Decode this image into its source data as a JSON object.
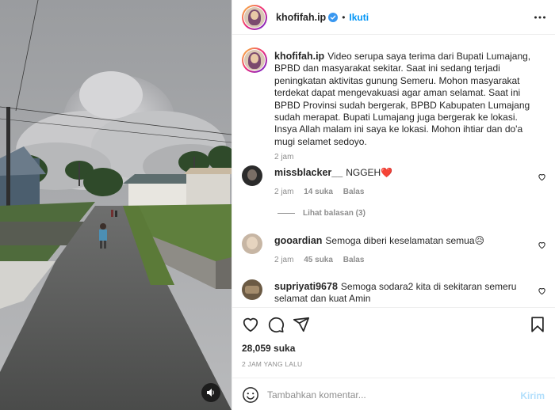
{
  "post": {
    "username": "khofifah.ip",
    "follow_label": "Ikuti",
    "caption": "Video serupa saya terima dari Bupati Lumajang, BPBD dan masyarakat sekitar. Saat ini sedang terjadi peningkatan aktivitas gunung Semeru. Mohon masyarakat terdekat dapat mengevakuasi agar aman selamat. Saat ini BPBD Provinsi sudah bergerak, BPBD Kabupaten Lumajang sudah merapat. Bupati Lumajang juga bergerak ke lokasi. Insya Allah malam ini saya ke lokasi. Mohon ihtiar dan do'a mugi selamet sedoyo.",
    "caption_age": "2 jam",
    "likes_text": "28,059 suka",
    "timestamp": "2 JAM YANG LALU"
  },
  "comments": [
    {
      "username": "missblacker__",
      "text": "NGGEH❤️",
      "age": "2 jam",
      "likes": "14 suka",
      "reply_label": "Balas",
      "view_replies": "Lihat balasan (3)"
    },
    {
      "username": "gooardian",
      "text": "Semoga diberi keselamatan semua😥",
      "age": "2 jam",
      "likes": "45 suka",
      "reply_label": "Balas"
    },
    {
      "username": "supriyati9678",
      "text": "Semoga sodara2 kita di sekitaran semeru selamat dan kuat Amin"
    }
  ],
  "composer": {
    "placeholder": "Tambahkan komentar...",
    "post_label": "Kirim"
  },
  "icons": {
    "verified": "verified-badge-icon",
    "more": "more-options-icon",
    "like": "heart-icon",
    "comment": "comment-icon",
    "share": "share-icon",
    "save": "bookmark-icon",
    "emoji": "emoji-icon",
    "sound": "speaker-icon"
  },
  "colors": {
    "accent": "#0095f6",
    "verified": "#3897f0",
    "muted_text": "#8e8e8e",
    "post_disabled": "#b2dffc"
  }
}
